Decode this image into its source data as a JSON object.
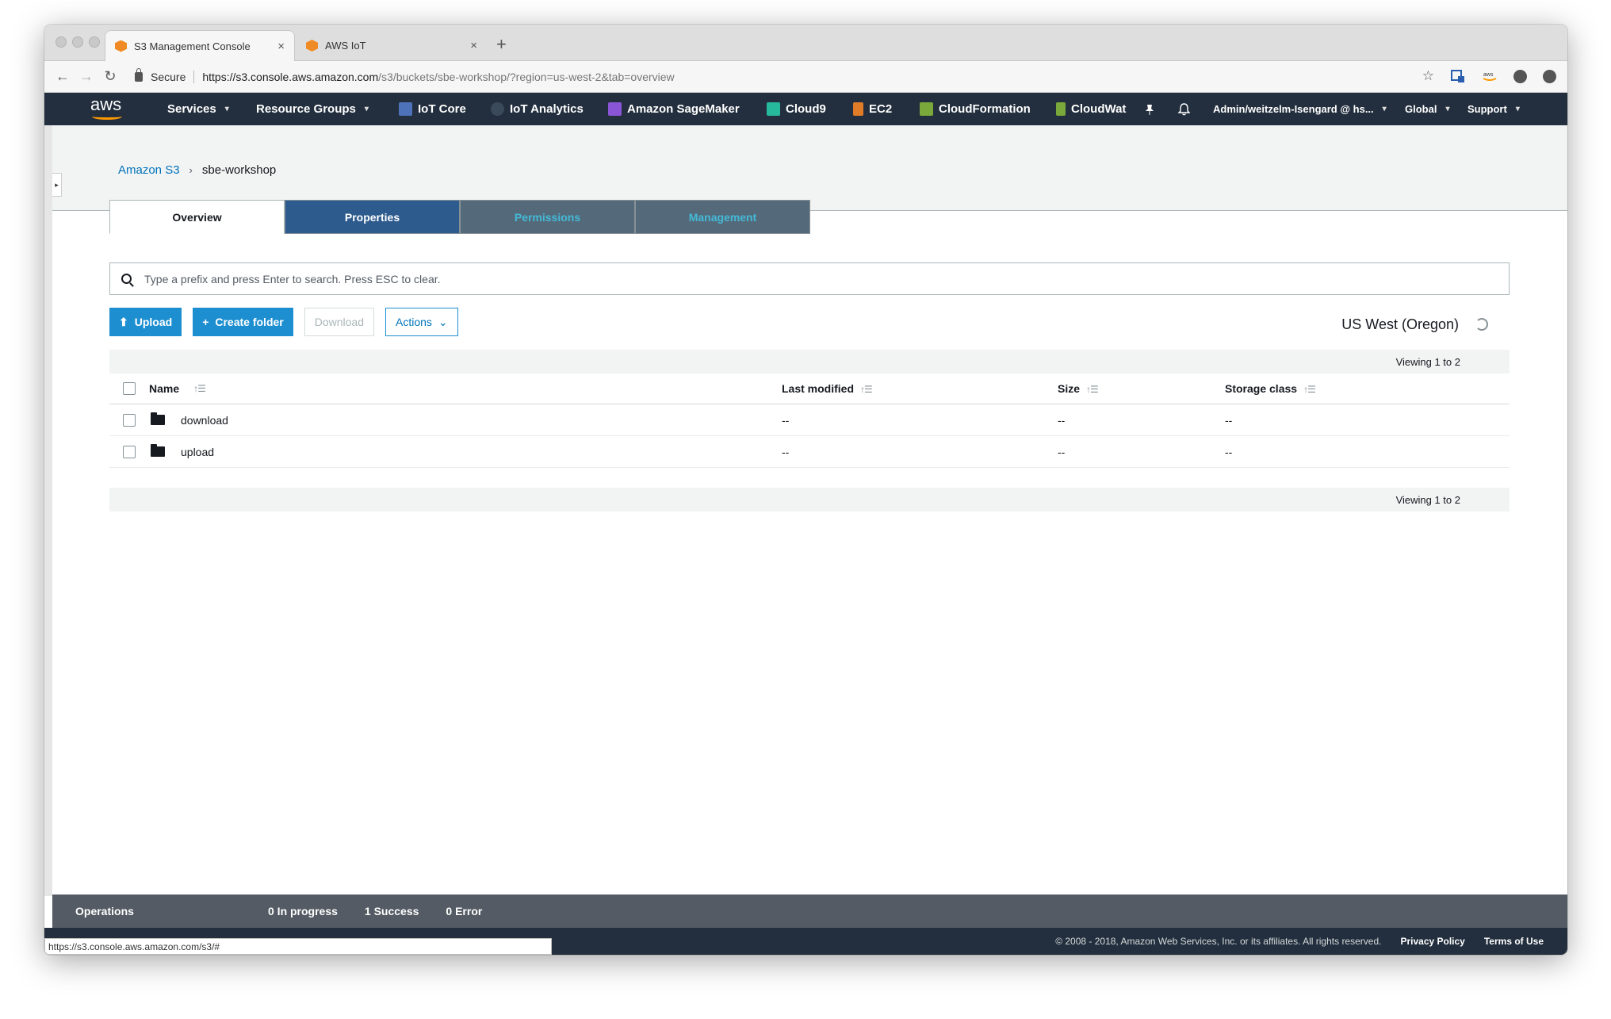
{
  "browser": {
    "tabs": [
      {
        "title": "S3 Management Console",
        "close": "×"
      },
      {
        "title": "AWS IoT",
        "close": "×"
      }
    ],
    "new_tab": "+",
    "nav": {
      "back": "←",
      "forward": "→",
      "reload": "↻"
    },
    "secure_label": "Secure",
    "url_main": "https://s3.console.aws.amazon.com",
    "url_path": "/s3/buckets/sbe-workshop/?region=us-west-2&tab=overview",
    "star": "☆",
    "status_url": "https://s3.console.aws.amazon.com/s3/#"
  },
  "aws_nav": {
    "logo": "aws",
    "items": [
      {
        "label": "Services",
        "caret": "▾"
      },
      {
        "label": "Resource Groups",
        "caret": "▾"
      },
      {
        "label": "IoT Core",
        "icon_color": "#4d72b9"
      },
      {
        "label": "IoT Analytics",
        "icon_color": "#3b4a5a"
      },
      {
        "label": "Amazon SageMaker",
        "icon_color": "#8a55d6"
      },
      {
        "label": "Cloud9",
        "icon_color": "#27b99b"
      },
      {
        "label": "EC2",
        "icon_color": "#e07b28"
      },
      {
        "label": "CloudFormation",
        "icon_color": "#7aa83b"
      },
      {
        "label": "CloudWat",
        "icon_color": "#7aa83b"
      }
    ],
    "pin_icon": "📌",
    "bell_icon": "🔔",
    "account": "Admin/weitzelm-Isengard @ hs...",
    "region": "Global",
    "support": "Support",
    "caret": "▾"
  },
  "breadcrumb": {
    "root": "Amazon S3",
    "separator": "›",
    "current": "sbe-workshop"
  },
  "content_tabs": [
    {
      "label": "Overview"
    },
    {
      "label": "Properties"
    },
    {
      "label": "Permissions"
    },
    {
      "label": "Management"
    }
  ],
  "search": {
    "placeholder": "Type a prefix and press Enter to search. Press ESC to clear."
  },
  "toolbar": {
    "upload": "Upload",
    "upload_icon": "⬆",
    "create_folder": "Create folder",
    "create_icon": "+",
    "download": "Download",
    "actions": "Actions",
    "actions_caret": "⌄"
  },
  "region_label": "US West (Oregon)",
  "table": {
    "viewing": "Viewing 1 to 2",
    "columns": [
      "Name",
      "Last modified",
      "Size",
      "Storage class"
    ],
    "sort_glyph": "↑☰",
    "rows": [
      {
        "name": "download",
        "modified": "--",
        "size": "--",
        "storage": "--"
      },
      {
        "name": "upload",
        "modified": "--",
        "size": "--",
        "storage": "--"
      }
    ]
  },
  "operations": {
    "label": "Operations",
    "in_progress": "0 In progress",
    "success": "1 Success",
    "error": "0 Error"
  },
  "footer": {
    "copyright": "© 2008 - 2018, Amazon Web Services, Inc. or its affiliates. All rights reserved.",
    "privacy": "Privacy Policy",
    "terms": "Terms of Use"
  }
}
